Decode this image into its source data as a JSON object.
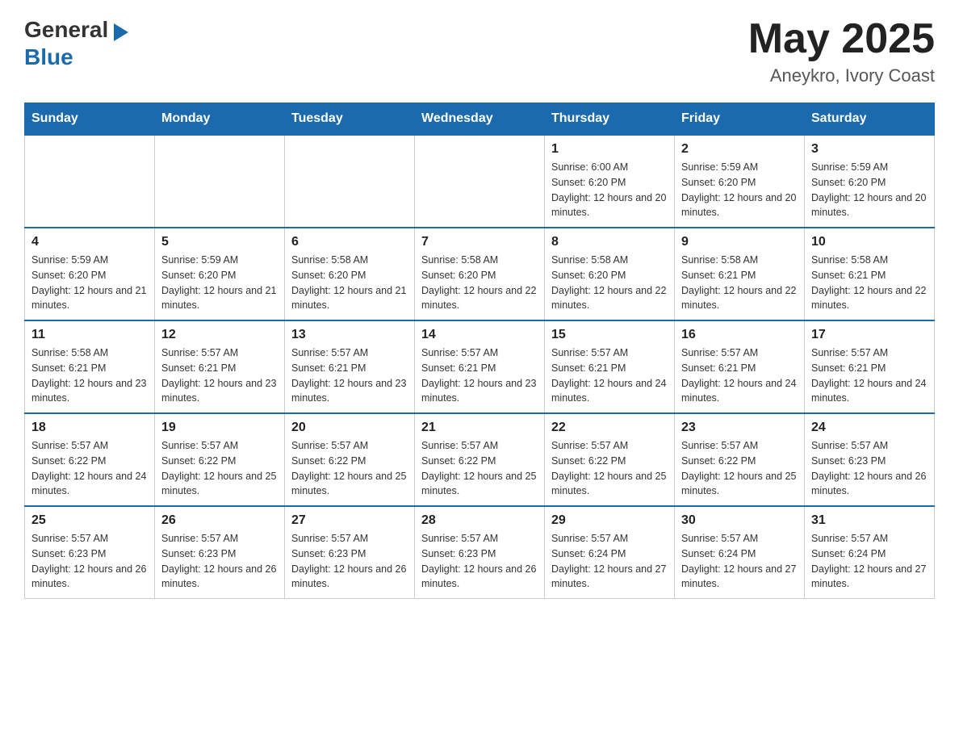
{
  "header": {
    "logo_general": "General",
    "logo_blue": "Blue",
    "month_year": "May 2025",
    "location": "Aneykro, Ivory Coast"
  },
  "days_of_week": [
    "Sunday",
    "Monday",
    "Tuesday",
    "Wednesday",
    "Thursday",
    "Friday",
    "Saturday"
  ],
  "weeks": [
    [
      {
        "day": "",
        "info": ""
      },
      {
        "day": "",
        "info": ""
      },
      {
        "day": "",
        "info": ""
      },
      {
        "day": "",
        "info": ""
      },
      {
        "day": "1",
        "info": "Sunrise: 6:00 AM\nSunset: 6:20 PM\nDaylight: 12 hours and 20 minutes."
      },
      {
        "day": "2",
        "info": "Sunrise: 5:59 AM\nSunset: 6:20 PM\nDaylight: 12 hours and 20 minutes."
      },
      {
        "day": "3",
        "info": "Sunrise: 5:59 AM\nSunset: 6:20 PM\nDaylight: 12 hours and 20 minutes."
      }
    ],
    [
      {
        "day": "4",
        "info": "Sunrise: 5:59 AM\nSunset: 6:20 PM\nDaylight: 12 hours and 21 minutes."
      },
      {
        "day": "5",
        "info": "Sunrise: 5:59 AM\nSunset: 6:20 PM\nDaylight: 12 hours and 21 minutes."
      },
      {
        "day": "6",
        "info": "Sunrise: 5:58 AM\nSunset: 6:20 PM\nDaylight: 12 hours and 21 minutes."
      },
      {
        "day": "7",
        "info": "Sunrise: 5:58 AM\nSunset: 6:20 PM\nDaylight: 12 hours and 22 minutes."
      },
      {
        "day": "8",
        "info": "Sunrise: 5:58 AM\nSunset: 6:20 PM\nDaylight: 12 hours and 22 minutes."
      },
      {
        "day": "9",
        "info": "Sunrise: 5:58 AM\nSunset: 6:21 PM\nDaylight: 12 hours and 22 minutes."
      },
      {
        "day": "10",
        "info": "Sunrise: 5:58 AM\nSunset: 6:21 PM\nDaylight: 12 hours and 22 minutes."
      }
    ],
    [
      {
        "day": "11",
        "info": "Sunrise: 5:58 AM\nSunset: 6:21 PM\nDaylight: 12 hours and 23 minutes."
      },
      {
        "day": "12",
        "info": "Sunrise: 5:57 AM\nSunset: 6:21 PM\nDaylight: 12 hours and 23 minutes."
      },
      {
        "day": "13",
        "info": "Sunrise: 5:57 AM\nSunset: 6:21 PM\nDaylight: 12 hours and 23 minutes."
      },
      {
        "day": "14",
        "info": "Sunrise: 5:57 AM\nSunset: 6:21 PM\nDaylight: 12 hours and 23 minutes."
      },
      {
        "day": "15",
        "info": "Sunrise: 5:57 AM\nSunset: 6:21 PM\nDaylight: 12 hours and 24 minutes."
      },
      {
        "day": "16",
        "info": "Sunrise: 5:57 AM\nSunset: 6:21 PM\nDaylight: 12 hours and 24 minutes."
      },
      {
        "day": "17",
        "info": "Sunrise: 5:57 AM\nSunset: 6:21 PM\nDaylight: 12 hours and 24 minutes."
      }
    ],
    [
      {
        "day": "18",
        "info": "Sunrise: 5:57 AM\nSunset: 6:22 PM\nDaylight: 12 hours and 24 minutes."
      },
      {
        "day": "19",
        "info": "Sunrise: 5:57 AM\nSunset: 6:22 PM\nDaylight: 12 hours and 25 minutes."
      },
      {
        "day": "20",
        "info": "Sunrise: 5:57 AM\nSunset: 6:22 PM\nDaylight: 12 hours and 25 minutes."
      },
      {
        "day": "21",
        "info": "Sunrise: 5:57 AM\nSunset: 6:22 PM\nDaylight: 12 hours and 25 minutes."
      },
      {
        "day": "22",
        "info": "Sunrise: 5:57 AM\nSunset: 6:22 PM\nDaylight: 12 hours and 25 minutes."
      },
      {
        "day": "23",
        "info": "Sunrise: 5:57 AM\nSunset: 6:22 PM\nDaylight: 12 hours and 25 minutes."
      },
      {
        "day": "24",
        "info": "Sunrise: 5:57 AM\nSunset: 6:23 PM\nDaylight: 12 hours and 26 minutes."
      }
    ],
    [
      {
        "day": "25",
        "info": "Sunrise: 5:57 AM\nSunset: 6:23 PM\nDaylight: 12 hours and 26 minutes."
      },
      {
        "day": "26",
        "info": "Sunrise: 5:57 AM\nSunset: 6:23 PM\nDaylight: 12 hours and 26 minutes."
      },
      {
        "day": "27",
        "info": "Sunrise: 5:57 AM\nSunset: 6:23 PM\nDaylight: 12 hours and 26 minutes."
      },
      {
        "day": "28",
        "info": "Sunrise: 5:57 AM\nSunset: 6:23 PM\nDaylight: 12 hours and 26 minutes."
      },
      {
        "day": "29",
        "info": "Sunrise: 5:57 AM\nSunset: 6:24 PM\nDaylight: 12 hours and 27 minutes."
      },
      {
        "day": "30",
        "info": "Sunrise: 5:57 AM\nSunset: 6:24 PM\nDaylight: 12 hours and 27 minutes."
      },
      {
        "day": "31",
        "info": "Sunrise: 5:57 AM\nSunset: 6:24 PM\nDaylight: 12 hours and 27 minutes."
      }
    ]
  ]
}
